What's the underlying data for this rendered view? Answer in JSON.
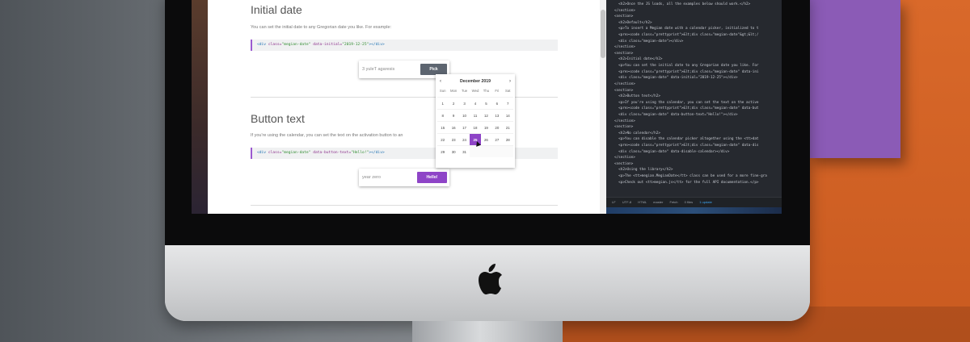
{
  "colors": {
    "accent": "#8e44c7",
    "pick_button": "#5d6570",
    "editor_bg": "#26292f"
  },
  "sections": {
    "initial_date": {
      "title": "Initial date",
      "description": "You can set the initial date to any Gregorian date you like. For example:",
      "code_tag_open": "<div",
      "code_class_attr": " class=",
      "code_class_val": "\"megian-date\"",
      "code_attr": " data-initial=",
      "code_attr_val": "\"2019-12-25\"",
      "code_close": "></div>",
      "input_value": "3 yuleT agaresis",
      "button_label": "Pick"
    },
    "button_text": {
      "title": "Button text",
      "description": "If you're using the calendar, you can set the text on the activation button to an",
      "code_tag_open": "<div",
      "code_class_attr": " class=",
      "code_class_val": "\"megian-date\"",
      "code_attr": " data-button-text=",
      "code_attr_val": "\"Hello!\"",
      "code_close": "></div>",
      "input_value": "year zero",
      "button_label": "Hello!"
    }
  },
  "calendar": {
    "month_label": "December 2019",
    "prev_icon": "‹",
    "next_icon": "›",
    "weekdays": [
      "Sun",
      "Mon",
      "Tue",
      "Wed",
      "Thu",
      "Fri",
      "Sat"
    ],
    "days": [
      "1",
      "2",
      "3",
      "4",
      "5",
      "6",
      "7",
      "8",
      "9",
      "10",
      "11",
      "12",
      "13",
      "14",
      "15",
      "16",
      "17",
      "18",
      "19",
      "20",
      "21",
      "22",
      "23",
      "24",
      "25",
      "26",
      "27",
      "28",
      "29",
      "30",
      "31"
    ],
    "selected_day": "25"
  },
  "editor": {
    "lines": [
      "  <h2>Once the JS loads, all the examples below should work.</h2>",
      "</section>",
      "<section>",
      "  <h2>Default</h2>",
      "  <p>To insert a Megian date with a calendar picker, initialized to t",
      "  <pre><code class=\"prettyprint\">&lt;div class=\"megian-date\"&gt;&lt;/",
      "  <div class=\"megian-date\"></div>",
      "</section>",
      "<section>",
      "  <h2>Initial date</h2>",
      "  <p>You can set the initial date to any Gregorian date you like. For",
      "  <pre><code class=\"prettyprint\">&lt;div class=\"megian-date\" data-ini",
      "  <div class=\"megian-date\" data-initial=\"2019-12-25\"></div>",
      "</section>",
      "<section>",
      "  <h2>Button text</h2>",
      "  <p>If you're using the calendar, you can set the text on the active",
      "  <pre><code class=\"prettyprint\">&lt;div class=\"megian-date\" data-but",
      "  <div class=\"megian-date\" data-button-text=\"Hello!\"></div>",
      "</section>",
      "<section>",
      "  <h2>No calendar</h2>",
      "  <p>You can disable the calendar picker altogether using the <tt>dat",
      "  <pre><code class=\"prettyprint\">&lt;div class=\"megian-date\" data-dis",
      "  <div class=\"megian-date\" data-disable-calendar></div>",
      "</section>",
      "<section>",
      "  <h2>Using the library</h2>",
      "  <p>The <tt>megian.MegianDate</tt> class can be used for a more fine-gra",
      "  <p>Check out <tt>megian.js</tt> for the full API documentation.</p>"
    ],
    "status": [
      "LF",
      "UTF-8",
      "HTML",
      "Fetch",
      "0 files",
      "1 update"
    ],
    "status_extra": "master"
  }
}
